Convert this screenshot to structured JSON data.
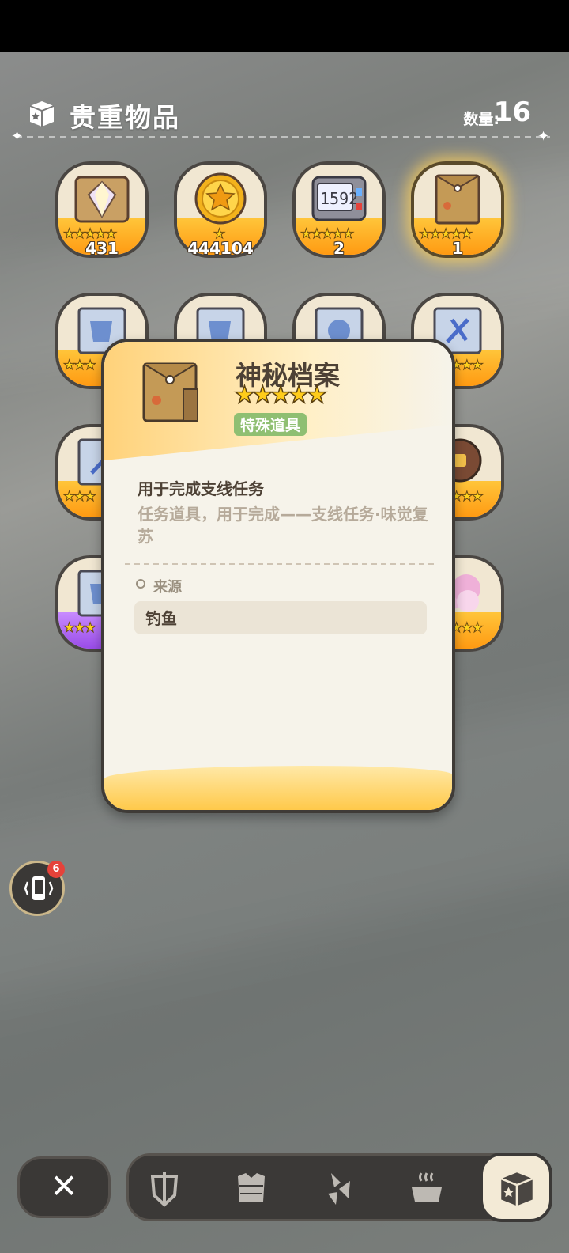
{
  "header": {
    "title": "贵重物品",
    "count_label": "数量:",
    "count_value": "16"
  },
  "items": [
    {
      "name": "crystal-chest",
      "stars": "★★★★★",
      "quantity": "431"
    },
    {
      "name": "star-coin",
      "stars": "★",
      "quantity": "444104"
    },
    {
      "name": "clock-device",
      "stars": "★★★★★",
      "quantity": "2"
    },
    {
      "name": "mystery-file",
      "stars": "★★★★★",
      "quantity": "1"
    }
  ],
  "popup": {
    "name": "神秘档案",
    "stars": "★★★★★",
    "tag": "特殊道具",
    "desc_title": "用于完成支线任务",
    "desc": "任务道具，用于完成——支线任务·味觉复苏",
    "source_label": "来源",
    "source_value": "钓鱼"
  },
  "phone": {
    "badge": "6"
  },
  "nav": {
    "close": "✕"
  },
  "colors": {
    "accent": "#ffc53a",
    "badge": "#e5423a",
    "tag": "#8fbf72"
  }
}
